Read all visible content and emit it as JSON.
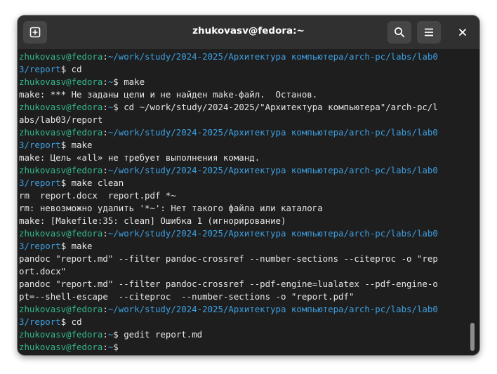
{
  "window": {
    "title": "zhukovasv@fedora:~"
  },
  "icons": {
    "new_tab": "new-tab-icon",
    "search": "search-icon",
    "menu": "hamburger-menu-icon",
    "close": "close-icon"
  },
  "colors": {
    "username": "#33b88a",
    "path": "#3d9fe0",
    "text": "#e6e6e6",
    "background": "#1e1e1e"
  },
  "terminal": {
    "lines": [
      [
        {
          "t": "zhukovasv@fedora",
          "c": "u"
        },
        {
          "t": ":"
        },
        {
          "t": "~/work/study/2024-2025/Архитектура компьютера/arch-pc/labs/lab0",
          "c": "p"
        }
      ],
      [
        {
          "t": "3/report",
          "c": "p"
        },
        {
          "t": "$ cd"
        }
      ],
      [
        {
          "t": "zhukovasv@fedora",
          "c": "u"
        },
        {
          "t": ":"
        },
        {
          "t": "~",
          "c": "p"
        },
        {
          "t": "$ make"
        }
      ],
      [
        {
          "t": "make: *** Не заданы цели и не найден make-файл.  Останов."
        }
      ],
      [
        {
          "t": "zhukovasv@fedora",
          "c": "u"
        },
        {
          "t": ":"
        },
        {
          "t": "~",
          "c": "p"
        },
        {
          "t": "$ cd ~/work/study/2024-2025/\"Архитектура компьютера\"/arch-pc/l"
        }
      ],
      [
        {
          "t": "abs/lab03/report"
        }
      ],
      [
        {
          "t": "zhukovasv@fedora",
          "c": "u"
        },
        {
          "t": ":"
        },
        {
          "t": "~/work/study/2024-2025/Архитектура компьютера/arch-pc/labs/lab0",
          "c": "p"
        }
      ],
      [
        {
          "t": "3/report",
          "c": "p"
        },
        {
          "t": "$ make"
        }
      ],
      [
        {
          "t": "make: Цель «all» не требует выполнения команд."
        }
      ],
      [
        {
          "t": "zhukovasv@fedora",
          "c": "u"
        },
        {
          "t": ":"
        },
        {
          "t": "~/work/study/2024-2025/Архитектура компьютера/arch-pc/labs/lab0",
          "c": "p"
        }
      ],
      [
        {
          "t": "3/report",
          "c": "p"
        },
        {
          "t": "$ make clean"
        }
      ],
      [
        {
          "t": "rm  report.docx  report.pdf *~"
        }
      ],
      [
        {
          "t": "rm: невозможно удалить '*~': Нет такого файла или каталога"
        }
      ],
      [
        {
          "t": "make: [Makefile:35: clean] Ошибка 1 (игнорирование)"
        }
      ],
      [
        {
          "t": "zhukovasv@fedora",
          "c": "u"
        },
        {
          "t": ":"
        },
        {
          "t": "~/work/study/2024-2025/Архитектура компьютера/arch-pc/labs/lab0",
          "c": "p"
        }
      ],
      [
        {
          "t": "3/report",
          "c": "p"
        },
        {
          "t": "$ make"
        }
      ],
      [
        {
          "t": "pandoc \"report.md\" --filter pandoc-crossref --number-sections --citeproc -o \"rep"
        }
      ],
      [
        {
          "t": "ort.docx\""
        }
      ],
      [
        {
          "t": "pandoc \"report.md\" --filter pandoc-crossref --pdf-engine=lualatex --pdf-engine-o"
        }
      ],
      [
        {
          "t": "pt=--shell-escape  --citeproc  --number-sections -o \"report.pdf\""
        }
      ],
      [
        {
          "t": "zhukovasv@fedora",
          "c": "u"
        },
        {
          "t": ":"
        },
        {
          "t": "~/work/study/2024-2025/Архитектура компьютера/arch-pc/labs/lab0",
          "c": "p"
        }
      ],
      [
        {
          "t": "3/report",
          "c": "p"
        },
        {
          "t": "$ cd"
        }
      ],
      [
        {
          "t": "zhukovasv@fedora",
          "c": "u"
        },
        {
          "t": ":"
        },
        {
          "t": "~",
          "c": "p"
        },
        {
          "t": "$ gedit report.md"
        }
      ],
      [
        {
          "t": "zhukovasv@fedora",
          "c": "u"
        },
        {
          "t": ":"
        },
        {
          "t": "~",
          "c": "p"
        },
        {
          "t": "$ "
        }
      ]
    ]
  }
}
